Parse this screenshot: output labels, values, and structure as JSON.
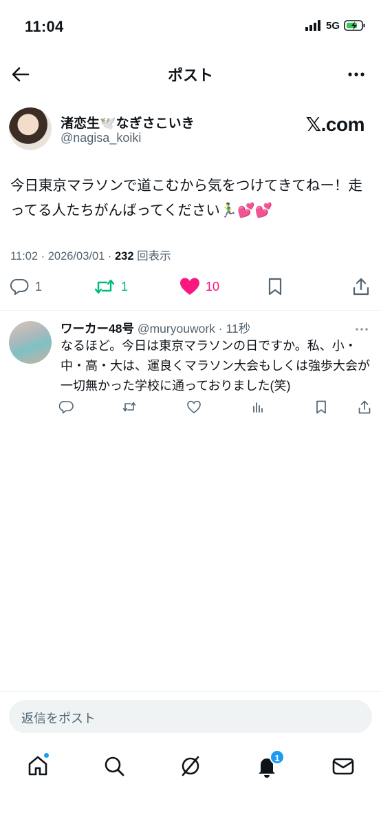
{
  "status_bar": {
    "time": "11:04",
    "network": "5G"
  },
  "header": {
    "title": "ポスト"
  },
  "author": {
    "display_name": "渚恋生🕊️なぎさこいき",
    "handle": "@nagisa_koiki",
    "watermark": "𝕏.com"
  },
  "post": {
    "text": "今日東京マラソンで道こむから気をつけてきてねー！走ってる人たちがんばってください🏃‍♂️💕💕",
    "timestamp": "11:02 · 2026/03/01 · ",
    "views_count": "232",
    "views_label": "回表示",
    "replies": "1",
    "reposts": "1",
    "likes": "10"
  },
  "reply": {
    "name": "ワーカー48号",
    "handle": "@muryouwork",
    "time": "· 11秒",
    "text": "なるほど。今日は東京マラソンの日ですか。私、小・中・高・大は、運良くマラソン大会もしくは強歩大会が一切無かった学校に通っておりました(笑)"
  },
  "reply_box": {
    "placeholder": "返信をポスト"
  },
  "tabbar": {
    "notifications_badge": "1"
  },
  "colors": {
    "accent": "#1d9bf0",
    "like": "#f91880",
    "repost": "#00ba7c",
    "muted": "#536471"
  }
}
